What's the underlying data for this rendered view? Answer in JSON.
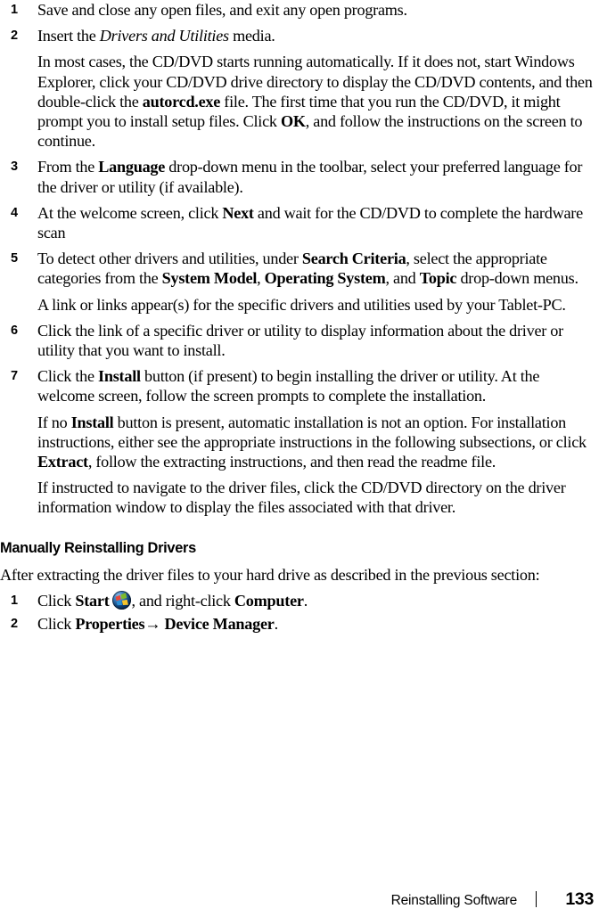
{
  "page": {
    "number": "133",
    "footer_title": "Reinstalling Software",
    "footer_separator": "|"
  },
  "steps_drivers_utilities": [
    {
      "num": "1",
      "text_html": "Save and close any open files, and exit any open programs."
    },
    {
      "num": "2",
      "text_html": "Insert the <i>Drivers and Utilities</i> media."
    },
    {
      "num": "3",
      "text_html": "From the <b>Language</b> drop-down menu in the toolbar, select your preferred language for the driver or utility (if available)."
    },
    {
      "num": "4",
      "text_html": "At the welcome screen, click <b>Next</b> and wait for the CD/DVD to complete the hardware scan"
    },
    {
      "num": "5",
      "text_html": "To detect other drivers and utilities, under <b>Search Criteria</b>, select the appropriate categories from the <b>System Model</b>, <b>Operating System</b>, and <b>Topic</b> drop-down menus."
    },
    {
      "num": "6",
      "text_html": "Click the link of a specific driver or utility to display information about the driver or utility that you want to install."
    },
    {
      "num": "7",
      "text_html": "Click the <b>Install</b> button (if present) to begin installing the driver or utility. At the welcome screen, follow the screen prompts to complete the installation."
    }
  ],
  "continuations": {
    "after_step2": "In most cases, the CD/DVD starts running automatically. If it does not, start Windows Explorer, click your CD/DVD drive directory to display the CD/DVD contents, and then double-click the <b>autorcd.exe</b> file. The first time that you run the CD/DVD, it might prompt you to install setup files. Click <b>OK</b>, and follow the instructions on the screen to continue.",
    "after_step5": "A link or links appear(s) for the specific drivers and utilities used by your Tablet-PC.",
    "after_step7_a": "If no <b>Install</b> button is present, automatic installation is not an option. For installation instructions, either see the appropriate instructions in the following subsections, or click <b>Extract</b>, follow the extracting instructions, and then read the readme file.",
    "after_step7_b": "If instructed to navigate to the driver files, click the CD/DVD directory on the driver information window to display the files associated with that driver."
  },
  "section": {
    "heading": "Manually Reinstalling Drivers",
    "intro": "After extracting the driver files to your hard drive as described in the previous section:",
    "steps": [
      {
        "num": "1",
        "pre_html": "Click <b>Start</b>",
        "icon": "windows-start-orb-icon",
        "post_html": ", and right-click <b>Computer</b>."
      },
      {
        "num": "2",
        "pre_html": "Click <b>Properties</b>&#8594; <b>Device Manager</b>.",
        "icon": null,
        "post_html": ""
      }
    ]
  },
  "colors": {
    "text": "#000000",
    "background": "#ffffff",
    "orb_blue_dark": "#05203f",
    "orb_blue_light": "#9fc8ea",
    "win_red": "#e8483a",
    "win_green": "#7fba2a",
    "win_blue": "#2a8fd4",
    "win_yellow": "#f7c52b"
  }
}
